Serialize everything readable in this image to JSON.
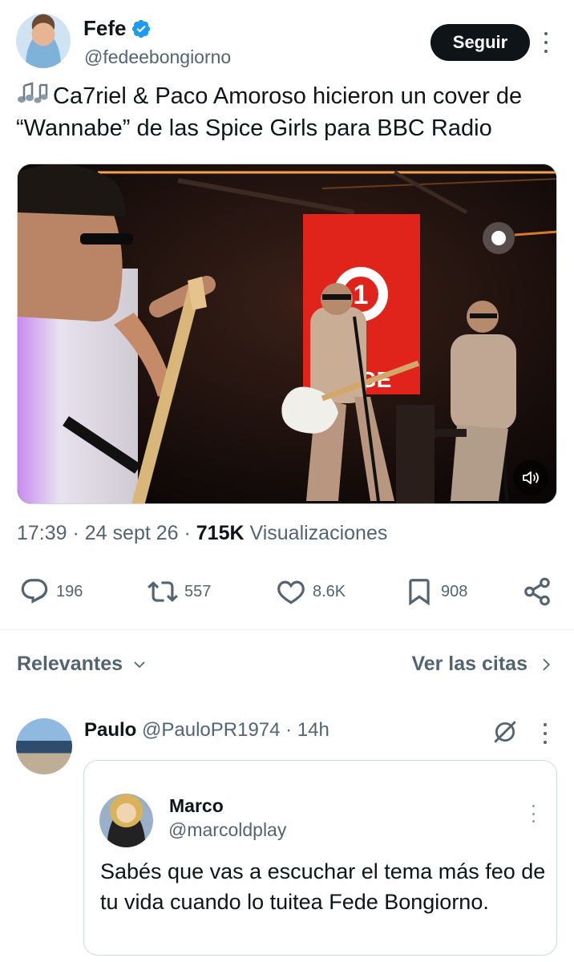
{
  "author": {
    "display_name": "Fefe",
    "handle": "@fedeebongiorno",
    "verified": true
  },
  "follow_label": "Seguir",
  "tweet": {
    "emoji": "🎶",
    "text": "Ca7riel & Paco Amoroso hicieron un cover de “Wannabe” de las Spice Girls para BBC Radio"
  },
  "media": {
    "type": "video",
    "sign_text": "NGE",
    "sign_number": "1"
  },
  "meta": {
    "time": "17:39",
    "date": "24 sept 26",
    "views_count": "715K",
    "views_label": "Visualizaciones"
  },
  "actions": {
    "replies": "196",
    "reposts": "557",
    "likes": "8.6K",
    "bookmarks": "908"
  },
  "sort": {
    "label": "Relevantes",
    "quotes_link": "Ver las citas"
  },
  "reply": {
    "display_name": "Paulo",
    "handle": "@PauloPR1974",
    "time": "· 14h",
    "quoted": {
      "display_name": "Marco",
      "handle": "@marcoldplay",
      "text": "Sabés que vas a escuchar el tema más feo de tu vida cuando lo tuitea Fede Bongiorno."
    }
  },
  "colors": {
    "text_primary": "#0f1419",
    "text_secondary": "#536471",
    "verified_blue": "#1d9bf0",
    "follow_button": "#0f1419",
    "divider": "#eff3f4"
  }
}
